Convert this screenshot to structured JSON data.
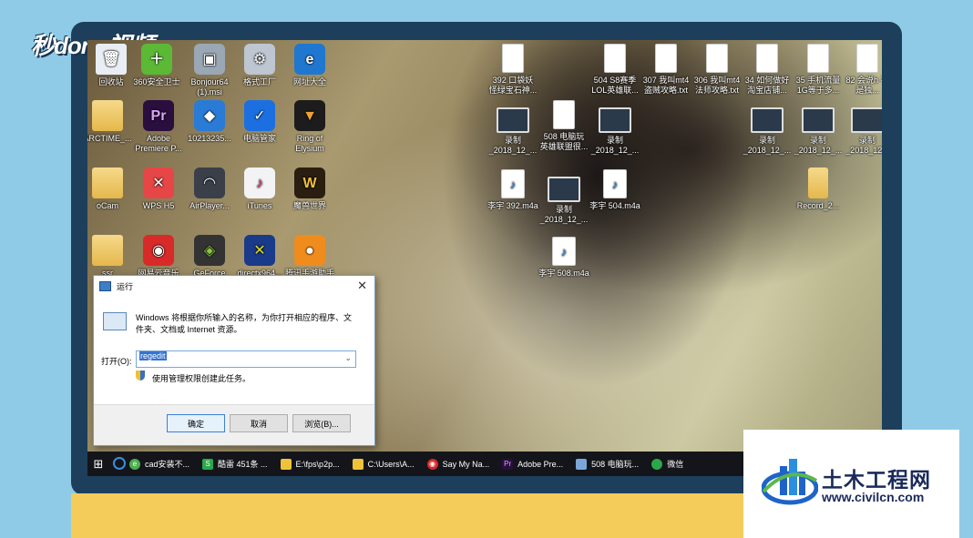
{
  "branding": {
    "video_logo": "秒dong视频"
  },
  "desktop_icons": [
    {
      "label": "回收站",
      "kind": "recycle"
    },
    {
      "label": "360安全卫士",
      "kind": "app",
      "color": "#5bb936"
    },
    {
      "label": "Bonjour64 (1).msi",
      "kind": "app",
      "color": "#9aa7b5"
    },
    {
      "label": "格式工厂",
      "kind": "app",
      "color": "#bdc6d1"
    },
    {
      "label": "网址大全",
      "kind": "app",
      "color": "#1f77d0"
    },
    {
      "label": "ARCTIME_...",
      "kind": "folder"
    },
    {
      "label": "Adobe Premiere P...",
      "kind": "app",
      "color": "#2a0e3d",
      "glyph": "Pr"
    },
    {
      "label": "10213235...",
      "kind": "app",
      "color": "#2a7bd6"
    },
    {
      "label": "电脑管家",
      "kind": "app",
      "color": "#1c6fe0"
    },
    {
      "label": "Ring of Elysium",
      "kind": "app",
      "color": "#1c1c1c"
    },
    {
      "label": "oCam",
      "kind": "folder"
    },
    {
      "label": "WPS H5",
      "kind": "app",
      "color": "#e74646"
    },
    {
      "label": "AirPlayer...",
      "kind": "app",
      "color": "#3a3f4a"
    },
    {
      "label": "iTunes",
      "kind": "app",
      "color": "#f3f3f6"
    },
    {
      "label": "魔兽世界",
      "kind": "app",
      "color": "#2a1e10"
    },
    {
      "label": "ssr",
      "kind": "folder"
    },
    {
      "label": "网易云音乐",
      "kind": "app",
      "color": "#d92a2a"
    },
    {
      "label": "GeForce",
      "kind": "app",
      "color": "#333"
    },
    {
      "label": "directx964...",
      "kind": "app",
      "color": "#e0e020"
    },
    {
      "label": "腾讯手游助手",
      "kind": "app",
      "color": "#f08b1e"
    },
    {
      "label": "392 口袋妖 怪绿宝石神...",
      "kind": "doc"
    },
    {
      "label": "504 S8赛季 LOL英雄联...",
      "kind": "doc"
    },
    {
      "label": "307 我叫mt4 盗贼攻略.txt",
      "kind": "doc"
    },
    {
      "label": "306 我叫mt4 法师攻略.txt",
      "kind": "doc"
    },
    {
      "label": "34 如何做好 淘宝店铺...",
      "kind": "doc"
    },
    {
      "label": "35 手机流量 1G等于多...",
      "kind": "doc"
    },
    {
      "label": "82 会说h 不是独...",
      "kind": "doc"
    },
    {
      "label": "录制 _2018_12_...",
      "kind": "video"
    },
    {
      "label": "508 电脑玩 英雄联盟很...",
      "kind": "doc"
    },
    {
      "label": "录制 _2018_12_...",
      "kind": "video"
    },
    {
      "label": "录制 _2018_12_...",
      "kind": "video"
    },
    {
      "label": "录制 _2018_12_...",
      "kind": "video"
    },
    {
      "label": "录制 _2018_12...",
      "kind": "video"
    },
    {
      "label": "李宇 392.m4a",
      "kind": "m4a"
    },
    {
      "label": "录制 _2018_12_...",
      "kind": "video"
    },
    {
      "label": "李宇 504.m4a",
      "kind": "m4a"
    },
    {
      "label": "Record_2...",
      "kind": "folder"
    },
    {
      "label": "李宇 508.m4a",
      "kind": "m4a"
    }
  ],
  "run_dialog": {
    "title": "运行",
    "description": "Windows 将根据你所输入的名称，为你打开相应的程序、文件夹、文档或 Internet 资源。",
    "open_label": "打开(O):",
    "open_value": "regedit",
    "admin_note": "使用管理权限创建此任务。",
    "ok_label": "确定",
    "cancel_label": "取消",
    "browse_label": "浏览(B)..."
  },
  "taskbar": {
    "items": [
      {
        "label": "cad安装不...",
        "color": "#4caf50"
      },
      {
        "label": "酷雷 451条 ...",
        "color": "#2aa84a"
      },
      {
        "label": "E:\\fps\\p2p...",
        "color": "#f0c23a"
      },
      {
        "label": "C:\\Users\\A...",
        "color": "#f0c23a"
      },
      {
        "label": "Say My Na...",
        "color": "#d92a2a"
      },
      {
        "label": "Adobe Pre...",
        "color": "#2a0e3d"
      },
      {
        "label": "508 电脑玩...",
        "color": "#7aa7d8"
      },
      {
        "label": "微信",
        "color": "#2aa84a"
      }
    ]
  },
  "watermark": {
    "title": "土木工程网",
    "url": "www.civilcn.com"
  }
}
